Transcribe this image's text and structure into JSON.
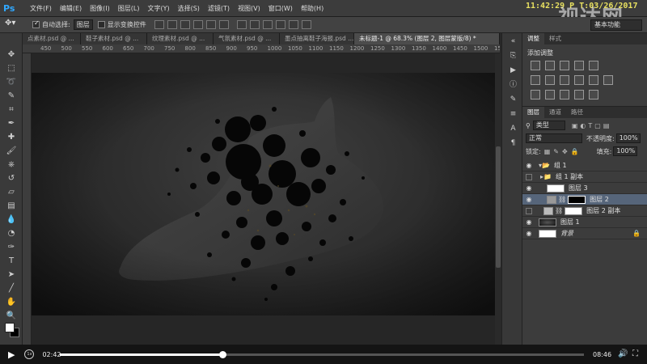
{
  "app": {
    "logo": "Ps",
    "menus": [
      "文件(F)",
      "编辑(E)",
      "图像(I)",
      "图层(L)",
      "文字(Y)",
      "选择(S)",
      "滤镜(T)",
      "视图(V)",
      "窗口(W)",
      "帮助(H)"
    ],
    "clock": "11:42:29  P  T:03/26/2017",
    "watermark": "视达网"
  },
  "options": {
    "auto_select_label": "自动选择:",
    "auto_select_value": "图层",
    "show_transform_label": "显示变换控件",
    "workspace": "基本功能"
  },
  "tabs": [
    {
      "label": "点素材.psd @ ...",
      "active": false
    },
    {
      "label": "鞋子素材.psd @ ...",
      "active": false
    },
    {
      "label": "纹理素材.psd @ ...",
      "active": false
    },
    {
      "label": "气氛素材.psd @ ...",
      "active": false
    },
    {
      "label": "墨点抽离鞋子海报.psd ...",
      "active": false
    },
    {
      "label": "未标题-1 @ 68.3% (图层 2, 图层蒙版/8) *",
      "active": true
    }
  ],
  "ruler": {
    "ticks": [
      "450",
      "500",
      "550",
      "600",
      "650",
      "700",
      "750",
      "800",
      "850",
      "900",
      "950",
      "1000",
      "1050",
      "1100",
      "1150",
      "1200",
      "1250",
      "1300",
      "1350",
      "1400",
      "1450",
      "1500",
      "1550"
    ]
  },
  "adjustments": {
    "tabs": [
      "调整",
      "样式"
    ],
    "title": "添加调整"
  },
  "layers_panel": {
    "tabs": [
      "图层",
      "通道",
      "路径"
    ],
    "filter": "类型",
    "blend_mode": "正常",
    "opacity_label": "不透明度:",
    "opacity_value": "100%",
    "lock_label": "锁定:",
    "fill_label": "填充:",
    "fill_value": "100%",
    "layers": [
      {
        "name": "组 1",
        "visible": true,
        "selected": false,
        "kind": "group-open"
      },
      {
        "name": "组 1 副本",
        "visible": false,
        "selected": false,
        "kind": "group"
      },
      {
        "name": "图层 3",
        "visible": true,
        "selected": false,
        "kind": "layer"
      },
      {
        "name": "图层 2",
        "visible": true,
        "selected": true,
        "kind": "masked"
      },
      {
        "name": "图层 2 副本",
        "visible": false,
        "selected": false,
        "kind": "masked"
      },
      {
        "name": "图层 1",
        "visible": true,
        "selected": false,
        "kind": "layer"
      },
      {
        "name": "背景",
        "visible": true,
        "selected": false,
        "kind": "background"
      }
    ]
  },
  "video": {
    "current_time": "02:42",
    "total_time": "08:46",
    "progress": 0.31
  }
}
